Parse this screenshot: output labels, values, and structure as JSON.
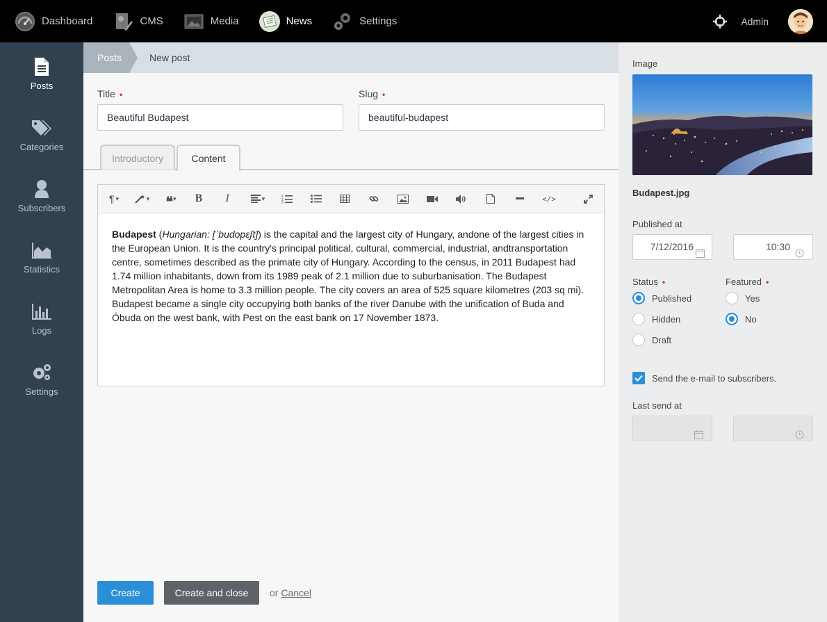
{
  "topnav": {
    "items": [
      {
        "label": "Dashboard",
        "icon": "dashboard-gauge-icon"
      },
      {
        "label": "CMS",
        "icon": "cms-icon"
      },
      {
        "label": "Media",
        "icon": "media-photo-icon"
      },
      {
        "label": "News",
        "icon": "news-icon",
        "active": true
      },
      {
        "label": "Settings",
        "icon": "settings-gears-icon"
      }
    ],
    "user": "Admin"
  },
  "sidebar": {
    "items": [
      {
        "label": "Posts",
        "icon": "document-icon",
        "active": true
      },
      {
        "label": "Categories",
        "icon": "tags-icon"
      },
      {
        "label": "Subscribers",
        "icon": "user-icon"
      },
      {
        "label": "Statistics",
        "icon": "area-chart-icon"
      },
      {
        "label": "Logs",
        "icon": "bar-chart-icon"
      },
      {
        "label": "Settings",
        "icon": "cogs-icon"
      }
    ]
  },
  "breadcrumb": {
    "parent": "Posts",
    "current": "New post"
  },
  "form": {
    "title_label": "Title",
    "title_value": "Beautiful Budapest",
    "slug_label": "Slug",
    "slug_value": "beautiful-budapest",
    "required_mark": "•",
    "tabs": [
      {
        "label": "Introductory"
      },
      {
        "label": "Content",
        "active": true
      }
    ],
    "content": {
      "bold_lead": "Budapest",
      "open_paren": " (",
      "italic_part": "Hungarian: [ˈbudopɛʃt]",
      "body": ") is the capital and the largest city of Hungary, andone of the largest cities in the European Union. It is the country's principal political, cultural, commercial, industrial, andtransportation centre, sometimes described as the primate city of Hungary. According to the census, in 2011 Budapest had 1.74 million inhabitants, down from its 1989 peak of 2.1 million due to suburbanisation. The Budapest Metropolitan Area is home to 3.3 million people. The city covers an area of 525 square kilometres (203 sq mi). Budapest became a single city occupying both banks of the river Danube with the unification of Buda and Óbuda on the west bank, with Pest on the east bank on 17 November 1873."
    },
    "toolbar": {
      "bold": "B",
      "italic": "I"
    },
    "buttons": {
      "create": "Create",
      "create_close": "Create and close",
      "or": "or",
      "cancel": "Cancel"
    }
  },
  "right_panel": {
    "image_label": "Image",
    "image_name": "Budapest.jpg",
    "published_label": "Published at",
    "published_date": "7/12/2016",
    "published_time": "10:30",
    "status_label": "Status",
    "status_options": [
      "Published",
      "Hidden",
      "Draft"
    ],
    "status_selected": "Published",
    "featured_label": "Featured",
    "featured_options": [
      "Yes",
      "No"
    ],
    "featured_selected": "No",
    "send_email_label": "Send the e-mail to subscribers.",
    "send_email_checked": true,
    "last_send_label": "Last send at"
  },
  "colors": {
    "accent": "#2a8fd6",
    "sidebar": "#324150",
    "topbar": "#000000",
    "required": "#c0392b"
  }
}
